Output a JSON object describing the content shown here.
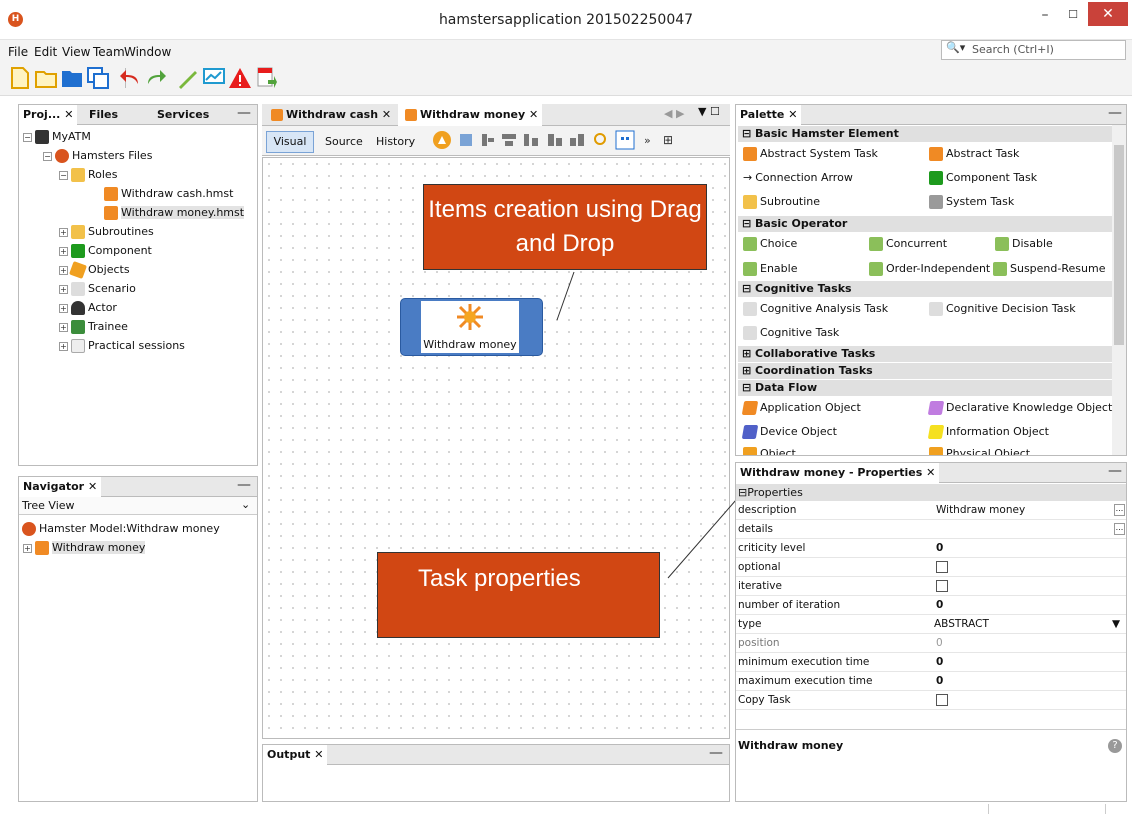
{
  "window": {
    "title": "hamstersapplication 201502250047",
    "minimize": "–",
    "maximize": "☐",
    "close": "✕"
  },
  "menu": [
    "File",
    "Edit",
    "View",
    "Team",
    "Window"
  ],
  "search": {
    "placeholder": "Search (Ctrl+I)"
  },
  "projects": {
    "tabs": [
      "Proj...",
      "Files",
      "Services"
    ],
    "tree": [
      "MyATM",
      "Hamsters Files",
      "Roles",
      "Withdraw cash.hmst",
      "Withdraw money.hmst",
      "Subroutines",
      "Component",
      "Objects",
      "Scenario",
      "Actor",
      "Trainee",
      "Practical sessions"
    ]
  },
  "navigator": {
    "title": "Navigator",
    "view": "Tree View",
    "model": "Hamster Model:Withdraw money",
    "item": "Withdraw money"
  },
  "editor": {
    "tabs": [
      "Withdraw cash",
      "Withdraw money"
    ],
    "modes": [
      "Visual",
      "Source",
      "History"
    ],
    "node_label": "Withdraw money",
    "callout1": "Items creation using Drag and Drop",
    "callout2": "Task properties"
  },
  "output": {
    "title": "Output"
  },
  "palette": {
    "title": "Palette",
    "cats": [
      "Basic Hamster Element",
      "Basic Operator",
      "Cognitive Tasks",
      "Collaborative Tasks",
      "Coordination Tasks",
      "Data Flow"
    ],
    "basic": [
      "Abstract System Task",
      "Abstract Task",
      "Connection Arrow",
      "Component Task",
      "Subroutine",
      "System Task"
    ],
    "ops": [
      "Choice",
      "Concurrent",
      "Disable",
      "Enable",
      "Order-Independent",
      "Suspend-Resume"
    ],
    "cog": [
      "Cognitive Analysis Task",
      "Cognitive Decision Task",
      "Cognitive Task"
    ],
    "df": [
      "Application Object",
      "Declarative Knowledge Object",
      "Device Object",
      "Information Object",
      "Object",
      "Physical Object"
    ]
  },
  "properties": {
    "title": "Withdraw money - Properties",
    "group": "Properties",
    "rows": [
      [
        "description",
        "Withdraw money"
      ],
      [
        "details",
        ""
      ],
      [
        "criticity level",
        "0"
      ],
      [
        "optional",
        ""
      ],
      [
        "iterative",
        ""
      ],
      [
        "number of iteration",
        "0"
      ],
      [
        "type",
        "ABSTRACT"
      ],
      [
        "position",
        "0"
      ],
      [
        "minimum execution time",
        "0"
      ],
      [
        "maximum execution time",
        "0"
      ],
      [
        "Copy Task",
        ""
      ]
    ],
    "footer": "Withdraw money"
  },
  "colors": {
    "accent": "#d14713",
    "node": "#4a7cc4"
  }
}
